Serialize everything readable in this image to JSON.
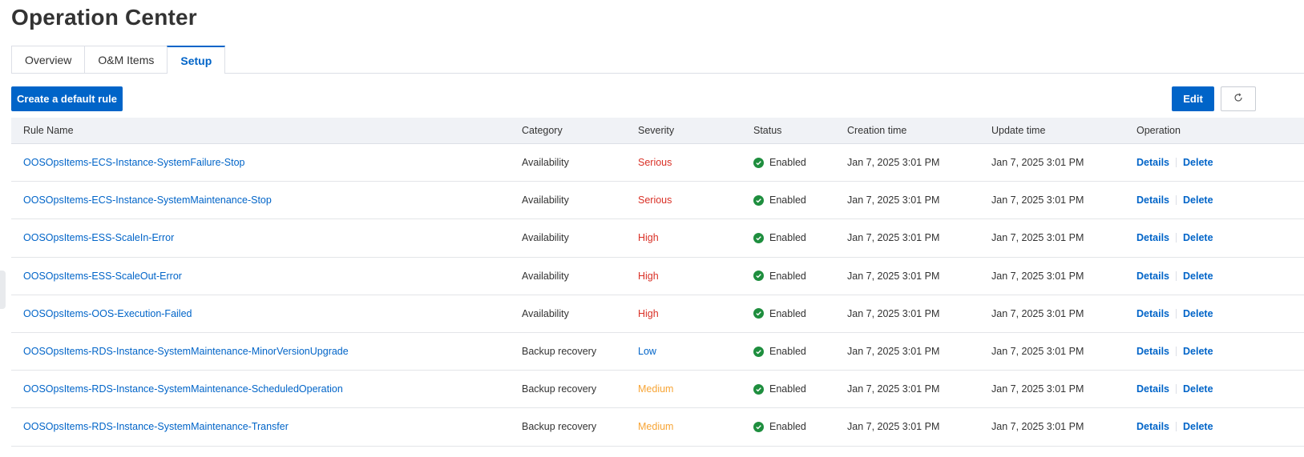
{
  "page": {
    "title": "Operation Center"
  },
  "tabs": [
    {
      "label": "Overview",
      "active": false
    },
    {
      "label": "O&M Items",
      "active": false
    },
    {
      "label": "Setup",
      "active": true
    }
  ],
  "toolbar": {
    "create_label": "Create a default rule",
    "edit_label": "Edit",
    "refresh_icon": "refresh-icon"
  },
  "colors": {
    "accent": "#0064c8",
    "serious": "#d93026",
    "high": "#d93026",
    "low": "#0064c8",
    "medium": "#f7a536",
    "enabled": "#1e8e3e"
  },
  "table": {
    "columns": [
      "Rule Name",
      "Category",
      "Severity",
      "Status",
      "Creation time",
      "Update time",
      "Operation"
    ],
    "rows": [
      {
        "name": "OOSOpsItems-ECS-Instance-SystemFailure-Stop",
        "category": "Availability",
        "severity": "Serious",
        "status": "Enabled",
        "created": "Jan 7, 2025 3:01 PM",
        "updated": "Jan 7, 2025 3:01 PM",
        "op_details": "Details",
        "op_delete": "Delete"
      },
      {
        "name": "OOSOpsItems-ECS-Instance-SystemMaintenance-Stop",
        "category": "Availability",
        "severity": "Serious",
        "status": "Enabled",
        "created": "Jan 7, 2025 3:01 PM",
        "updated": "Jan 7, 2025 3:01 PM",
        "op_details": "Details",
        "op_delete": "Delete"
      },
      {
        "name": "OOSOpsItems-ESS-ScaleIn-Error",
        "category": "Availability",
        "severity": "High",
        "status": "Enabled",
        "created": "Jan 7, 2025 3:01 PM",
        "updated": "Jan 7, 2025 3:01 PM",
        "op_details": "Details",
        "op_delete": "Delete"
      },
      {
        "name": "OOSOpsItems-ESS-ScaleOut-Error",
        "category": "Availability",
        "severity": "High",
        "status": "Enabled",
        "created": "Jan 7, 2025 3:01 PM",
        "updated": "Jan 7, 2025 3:01 PM",
        "op_details": "Details",
        "op_delete": "Delete"
      },
      {
        "name": "OOSOpsItems-OOS-Execution-Failed",
        "category": "Availability",
        "severity": "High",
        "status": "Enabled",
        "created": "Jan 7, 2025 3:01 PM",
        "updated": "Jan 7, 2025 3:01 PM",
        "op_details": "Details",
        "op_delete": "Delete"
      },
      {
        "name": "OOSOpsItems-RDS-Instance-SystemMaintenance-MinorVersionUpgrade",
        "category": "Backup recovery",
        "severity": "Low",
        "status": "Enabled",
        "created": "Jan 7, 2025 3:01 PM",
        "updated": "Jan 7, 2025 3:01 PM",
        "op_details": "Details",
        "op_delete": "Delete"
      },
      {
        "name": "OOSOpsItems-RDS-Instance-SystemMaintenance-ScheduledOperation",
        "category": "Backup recovery",
        "severity": "Medium",
        "status": "Enabled",
        "created": "Jan 7, 2025 3:01 PM",
        "updated": "Jan 7, 2025 3:01 PM",
        "op_details": "Details",
        "op_delete": "Delete"
      },
      {
        "name": "OOSOpsItems-RDS-Instance-SystemMaintenance-Transfer",
        "category": "Backup recovery",
        "severity": "Medium",
        "status": "Enabled",
        "created": "Jan 7, 2025 3:01 PM",
        "updated": "Jan 7, 2025 3:01 PM",
        "op_details": "Details",
        "op_delete": "Delete"
      }
    ]
  }
}
